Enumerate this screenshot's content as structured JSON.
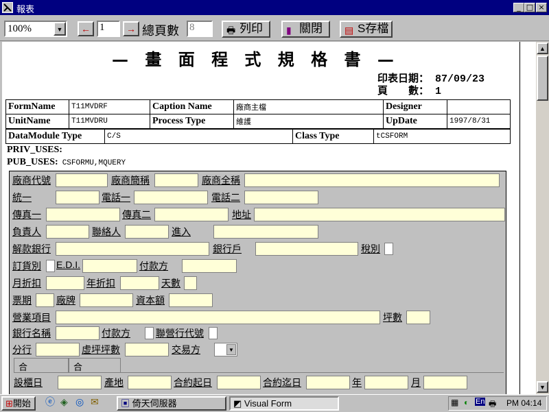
{
  "window": {
    "title": "報表",
    "min_label": "_",
    "max_label": "□",
    "close_label": "×"
  },
  "toolbar": {
    "zoom": "100%",
    "prev_icon": "←",
    "next_icon": "→",
    "page": "1",
    "total_label": "總頁數",
    "total": "8",
    "print_label": "列印",
    "close_label": "關閉",
    "save_label": "S存檔"
  },
  "report": {
    "title": "— 畫 面 程 式 規 格 書 —",
    "print_date_label": "印表日期：",
    "print_date": "87/09/23",
    "page_label": "頁　　數：",
    "page": "1",
    "info": {
      "formname_label": "FormName",
      "formname": "T11MVDRF",
      "caption_label": "Caption Name",
      "caption": "廠商主檔",
      "designer_label": "Designer",
      "designer": "",
      "unitname_label": "UnitName",
      "unitname": "T11MVDRU",
      "process_label": "Process Type",
      "process": "維護",
      "update_label": "UpDate",
      "update": "1997/8/31",
      "datamodule_label": "DataModule Type",
      "datamodule": "C/S",
      "class_label": "Class Type",
      "class": "tCSFORM"
    },
    "priv_label": "PRIV_USES:",
    "priv_value": "",
    "pub_label": "PUB_USES:",
    "pub_value": "CSFORMU,MQUERY"
  },
  "form": {
    "labels": [
      "廠商代號",
      "廠商簡稱",
      "廠商全稱",
      "統一",
      "電話一",
      "電話二",
      "傳真一",
      "傳真二",
      "地址",
      "負責人",
      "聯絡人",
      "進入",
      "解款銀行",
      "銀行戶",
      "稅別",
      "訂貨別",
      "E.D.I.",
      "付款方",
      "月折扣",
      "年折扣",
      "天數",
      "票期",
      "廠牌",
      "資本額",
      "營業項目",
      "坪數",
      "銀行名稱",
      "付款方",
      "聯營行代號",
      "分行",
      "虛坪坪數",
      "交易方",
      "設櫃日",
      "產地",
      "合約起日",
      "合約迄日",
      "年",
      "月"
    ],
    "tabs": [
      "合",
      "合"
    ]
  },
  "taskbar": {
    "start": "開始",
    "task1": "倚天伺服器",
    "task2": "Visual Form",
    "tray_lang": "En",
    "clock": "PM 04:14"
  }
}
